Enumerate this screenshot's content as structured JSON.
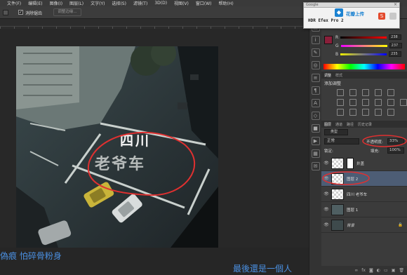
{
  "menubar": {
    "items": [
      "文件(F)",
      "编辑(E)",
      "图像(I)",
      "图层(L)",
      "文字(Y)",
      "选择(S)",
      "滤镜(T)",
      "3D(D)",
      "视图(V)",
      "窗口(W)",
      "帮助(H)"
    ]
  },
  "options": {
    "antialias_label": "消除锯齿",
    "refine_edge_label": "调整边缘..."
  },
  "popup": {
    "title_google": "Google",
    "upload_label": "花瓣上传",
    "app_name": "HDR Efex Pro 2",
    "icon_s": "S"
  },
  "color_panel": {
    "r_label": "R",
    "g_label": "G",
    "b_label": "B",
    "r_value": "238",
    "g_value": "237",
    "b_value": "235"
  },
  "adjustments": {
    "tab_adjust": "调整",
    "tab_styles": "样式",
    "add_label": "添加调整"
  },
  "layers": {
    "tabs": [
      "图层",
      "通道",
      "路径",
      "历史记录"
    ],
    "filter_label": "类型",
    "blend_mode": "正常",
    "opacity_label": "不透明度:",
    "opacity_value": "33%",
    "lock_label": "锁定:",
    "fill_label": "填充:",
    "fill_value": "100%",
    "items": [
      {
        "name": "背景",
        "opacity_hint": ""
      },
      {
        "name": "图层 1",
        "opacity_hint": ""
      },
      {
        "name": "四川 老爷车",
        "opacity_hint": ""
      },
      {
        "name": "图层 2",
        "opacity_hint": ""
      },
      {
        "name": "井盖",
        "opacity_hint": ""
      }
    ]
  },
  "photo": {
    "line1": "四川",
    "line2": "老爷车"
  },
  "captions": {
    "left": "偽痕 怕碎骨粉身",
    "right": "最後還是一個人"
  },
  "colors": {
    "accent_red": "#e03030",
    "panel_bg": "#3b3b3b",
    "selected_layer": "#4d5d75"
  }
}
